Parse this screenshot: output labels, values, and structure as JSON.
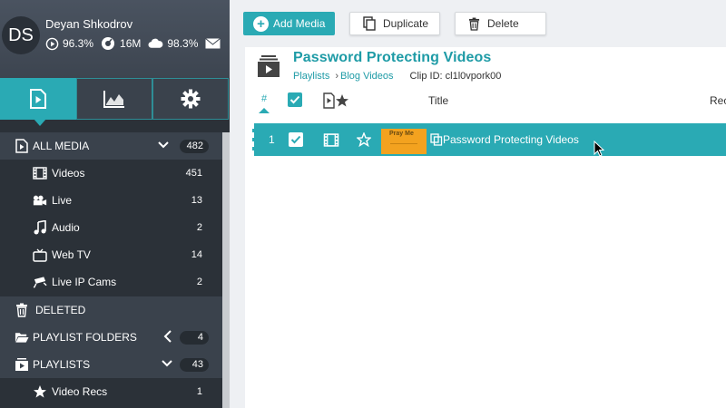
{
  "user": {
    "initials": "DS",
    "name": "Deyan Shkodrov",
    "stats": {
      "play": "96.3%",
      "bandwidth": "16M",
      "storage": "98.3%"
    }
  },
  "sidebar_tabs": [
    {
      "icon": "media-file-icon",
      "active": true
    },
    {
      "icon": "analytics-chart-icon",
      "active": false
    },
    {
      "icon": "settings-gear-icon",
      "active": false
    }
  ],
  "menu": {
    "all_media": {
      "label": "ALL MEDIA",
      "count": "482"
    },
    "videos": {
      "label": "Videos",
      "count": "451"
    },
    "live": {
      "label": "Live",
      "count": "13"
    },
    "audio": {
      "label": "Audio",
      "count": "2"
    },
    "webtv": {
      "label": "Web TV",
      "count": "14"
    },
    "ipcams": {
      "label": "Live IP Cams",
      "count": "2"
    },
    "deleted": {
      "label": "DELETED"
    },
    "folders": {
      "label": "PLAYLIST FOLDERS",
      "count": "4"
    },
    "playlists": {
      "label": "PLAYLISTS",
      "count": "43"
    },
    "video_recs": {
      "label": "Video Recs",
      "count": "1"
    }
  },
  "toolbar": {
    "add_label": "Add Media",
    "duplicate_label": "Duplicate",
    "delete_label": "Delete"
  },
  "playlist": {
    "title": "Password Protecting Videos",
    "breadcrumb_root": "Playlists",
    "breadcrumb_current": "Blog Videos",
    "clip_id": "Clip ID: cl1l0vpork00"
  },
  "table": {
    "headers": {
      "num": "#",
      "title": "Title",
      "rec": "Rec"
    },
    "rows": [
      {
        "num": "1",
        "thumb_text": "Pray Me",
        "title": "Password Protecting Videos",
        "checked": true
      }
    ]
  },
  "colors": {
    "accent": "#2aaab4",
    "sidebar": "#2b3138"
  }
}
